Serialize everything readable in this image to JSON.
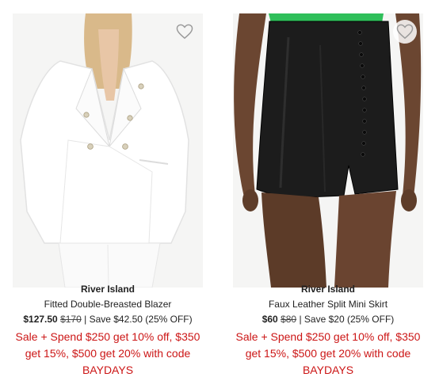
{
  "colors": {
    "promo": "#cc1616",
    "heart_outline": "#9a9a9a"
  },
  "products": [
    {
      "brand": "River Island",
      "name": "Fitted Double-Breasted Blazer",
      "sale_price": "$127.50",
      "original_price": "$170",
      "savings": "| Save $42.50 (25% OFF)",
      "promo": "Sale + Spend $250 get 10% off, $350 get 15%, $500 get 20% with code BAYDAYS",
      "wishlist_icon": "heart-outline-icon"
    },
    {
      "brand": "River Island",
      "name": "Faux Leather Split Mini Skirt",
      "sale_price": "$60",
      "original_price": "$80",
      "savings": "| Save $20 (25% OFF)",
      "promo": "Sale + Spend $250 get 10% off, $350 get 15%, $500 get 20% with code BAYDAYS",
      "wishlist_icon": "heart-outline-icon"
    }
  ]
}
